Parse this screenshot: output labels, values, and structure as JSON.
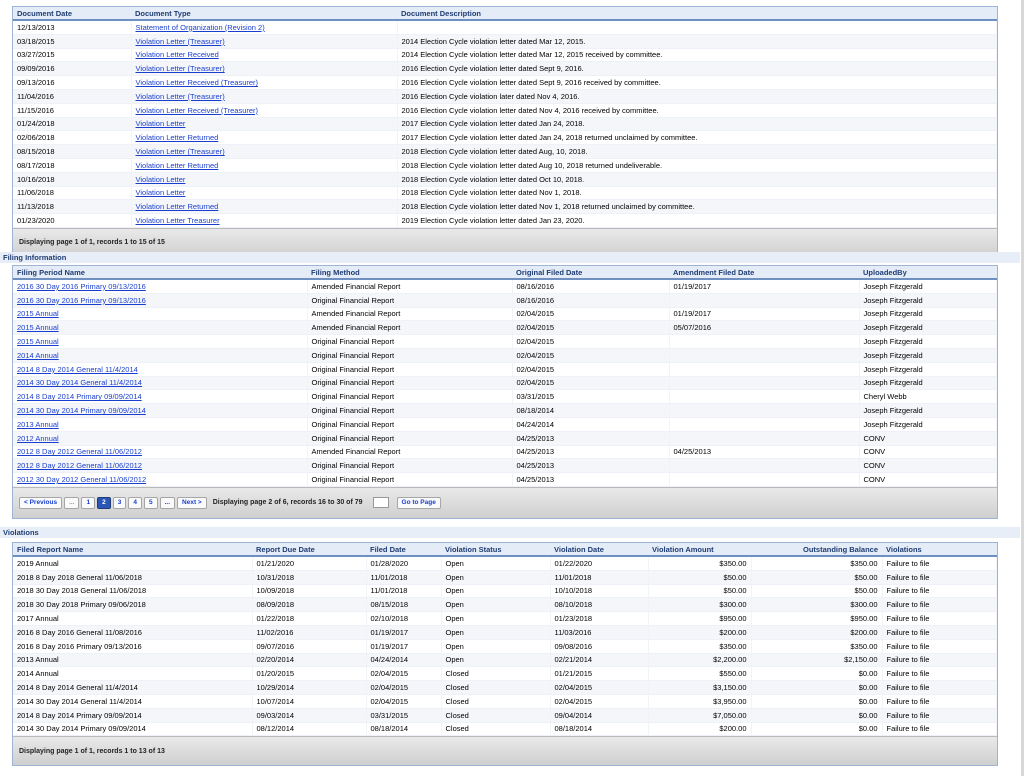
{
  "documents": {
    "headers": [
      "Document Date",
      "Document Type",
      "Document Description"
    ],
    "rows": [
      [
        "12/13/2013",
        "Statement of Organization (Revision 2)",
        ""
      ],
      [
        "03/18/2015",
        "Violation Letter (Treasurer)",
        "2014 Election Cycle violation letter dated Mar 12, 2015."
      ],
      [
        "03/27/2015",
        "Violation Letter Received",
        "2014 Election Cycle violation letter dated Mar 12, 2015 received by committee."
      ],
      [
        "09/09/2016",
        "Violation Letter (Treasurer)",
        "2016 Election Cycle violation letter dated Sept 9, 2016."
      ],
      [
        "09/13/2016",
        "Violation Letter Received (Treasurer)",
        "2016 Election Cycle violation letter dated Sept 9, 2016 received by committee."
      ],
      [
        "11/04/2016",
        "Violation Letter (Treasurer)",
        "2016 Election Cycle violation later dated Nov 4, 2016."
      ],
      [
        "11/15/2016",
        "Violation Letter Received (Treasurer)",
        "2016 Election Cycle violation letter dated Nov 4, 2016 received by committee."
      ],
      [
        "01/24/2018",
        "Violation Letter",
        "2017 Election Cycle violation letter dated Jan 24, 2018."
      ],
      [
        "02/06/2018",
        "Violation Letter Returned",
        "2017 Election Cycle violation letter dated Jan 24, 2018 returned unclaimed by committee."
      ],
      [
        "08/15/2018",
        "Violation Letter (Treasurer)",
        "2018 Election Cycle violation letter dated Aug, 10, 2018."
      ],
      [
        "08/17/2018",
        "Violation Letter Returned",
        "2018 Election Cycle violation letter dated Aug 10, 2018 returned undeliverable."
      ],
      [
        "10/16/2018",
        "Violation Letter",
        "2018 Election Cycle violation letter dated Oct 10, 2018."
      ],
      [
        "11/06/2018",
        "Violation Letter",
        "2018 Election Cycle violation letter dated Nov 1, 2018."
      ],
      [
        "11/13/2018",
        "Violation Letter Returned",
        "2018 Election Cycle violation letter dated Nov 1, 2018 returned unclaimed by committee."
      ],
      [
        "01/23/2020",
        "Violation Letter Treasurer",
        "2019 Election Cycle violation letter dated Jan 23, 2020."
      ]
    ],
    "footer": "Displaying page 1 of 1, records 1 to 15 of 15"
  },
  "filing": {
    "section_title": "Filing Information",
    "headers": [
      "Filing Period Name",
      "Filing Method",
      "Original Filed Date",
      "Amendment Filed Date",
      "UploadedBy"
    ],
    "rows": [
      [
        "2016 30 Day 2016 Primary 09/13/2016",
        "Amended Financial Report",
        "08/16/2016",
        "01/19/2017",
        "Joseph Fitzgerald"
      ],
      [
        "2016 30 Day 2016 Primary 09/13/2016",
        "Original Financial Report",
        "08/16/2016",
        "",
        "Joseph Fitzgerald"
      ],
      [
        "2015 Annual",
        "Amended Financial Report",
        "02/04/2015",
        "01/19/2017",
        "Joseph Fitzgerald"
      ],
      [
        "2015 Annual",
        "Amended Financial Report",
        "02/04/2015",
        "05/07/2016",
        "Joseph Fitzgerald"
      ],
      [
        "2015 Annual",
        "Original Financial Report",
        "02/04/2015",
        "",
        "Joseph Fitzgerald"
      ],
      [
        "2014 Annual",
        "Original Financial Report",
        "02/04/2015",
        "",
        "Joseph Fitzgerald"
      ],
      [
        "2014 8 Day 2014 General 11/4/2014",
        "Original Financial Report",
        "02/04/2015",
        "",
        "Joseph Fitzgerald"
      ],
      [
        "2014 30 Day 2014 General 11/4/2014",
        "Original Financial Report",
        "02/04/2015",
        "",
        "Joseph Fitzgerald"
      ],
      [
        "2014 8 Day 2014 Primary 09/09/2014",
        "Original Financial Report",
        "03/31/2015",
        "",
        "Cheryl Webb"
      ],
      [
        "2014 30 Day 2014 Primary 09/09/2014",
        "Original Financial Report",
        "08/18/2014",
        "",
        "Joseph Fitzgerald"
      ],
      [
        "2013 Annual",
        "Original Financial Report",
        "04/24/2014",
        "",
        "Joseph Fitzgerald"
      ],
      [
        "2012 Annual",
        "Original Financial Report",
        "04/25/2013",
        "",
        "CONV"
      ],
      [
        "2012 8 Day 2012 General 11/06/2012",
        "Amended Financial Report",
        "04/25/2013",
        "04/25/2013",
        "CONV"
      ],
      [
        "2012 8 Day 2012 General 11/06/2012",
        "Original Financial Report",
        "04/25/2013",
        "",
        "CONV"
      ],
      [
        "2012 30 Day 2012 General 11/06/2012",
        "Original Financial Report",
        "04/25/2013",
        "",
        "CONV"
      ]
    ],
    "pager": {
      "prev": "< Previous",
      "first_gap": "...",
      "pages": [
        "1",
        "2",
        "3",
        "4",
        "5"
      ],
      "current_page": "2",
      "last_gap": "...",
      "next": "Next >",
      "info": "Displaying page 2 of 6, records 16 to 30 of 79",
      "goto": "Go to Page"
    }
  },
  "violations": {
    "section_title": "Violations",
    "headers": [
      "Filed Report Name",
      "Report Due Date",
      "Filed Date",
      "Violation Status",
      "Violation Date",
      "Violation Amount",
      "Outstanding Balance",
      "Violations"
    ],
    "rows": [
      [
        "2019 Annual",
        "01/21/2020",
        "01/28/2020",
        "Open",
        "01/22/2020",
        "$350.00",
        "$350.00",
        "Failure to file"
      ],
      [
        "2018 8 Day 2018 General 11/06/2018",
        "10/31/2018",
        "11/01/2018",
        "Open",
        "11/01/2018",
        "$50.00",
        "$50.00",
        "Failure to file"
      ],
      [
        "2018 30 Day 2018 General 11/06/2018",
        "10/09/2018",
        "11/01/2018",
        "Open",
        "10/10/2018",
        "$50.00",
        "$50.00",
        "Failure to file"
      ],
      [
        "2018 30 Day 2018 Primary 09/06/2018",
        "08/09/2018",
        "08/15/2018",
        "Open",
        "08/10/2018",
        "$300.00",
        "$300.00",
        "Failure to file"
      ],
      [
        "2017 Annual",
        "01/22/2018",
        "02/10/2018",
        "Open",
        "01/23/2018",
        "$950.00",
        "$950.00",
        "Failure to file"
      ],
      [
        "2016 8 Day 2016 General 11/08/2016",
        "11/02/2016",
        "01/19/2017",
        "Open",
        "11/03/2016",
        "$200.00",
        "$200.00",
        "Failure to file"
      ],
      [
        "2016 8 Day 2016 Primary 09/13/2016",
        "09/07/2016",
        "01/19/2017",
        "Open",
        "09/08/2016",
        "$350.00",
        "$350.00",
        "Failure to file"
      ],
      [
        "2013 Annual",
        "02/20/2014",
        "04/24/2014",
        "Open",
        "02/21/2014",
        "$2,200.00",
        "$2,150.00",
        "Failure to file"
      ],
      [
        "2014 Annual",
        "01/20/2015",
        "02/04/2015",
        "Closed",
        "01/21/2015",
        "$550.00",
        "$0.00",
        "Failure to file"
      ],
      [
        "2014 8 Day 2014 General 11/4/2014",
        "10/29/2014",
        "02/04/2015",
        "Closed",
        "02/04/2015",
        "$3,150.00",
        "$0.00",
        "Failure to file"
      ],
      [
        "2014 30 Day 2014 General 11/4/2014",
        "10/07/2014",
        "02/04/2015",
        "Closed",
        "02/04/2015",
        "$3,950.00",
        "$0.00",
        "Failure to file"
      ],
      [
        "2014 8 Day 2014 Primary 09/09/2014",
        "09/03/2014",
        "03/31/2015",
        "Closed",
        "09/04/2014",
        "$7,050.00",
        "$0.00",
        "Failure to file"
      ],
      [
        "2014 30 Day 2014 Primary 09/09/2014",
        "08/12/2014",
        "08/18/2014",
        "Closed",
        "08/18/2014",
        "$200.00",
        "$0.00",
        "Failure to file"
      ]
    ],
    "footer": "Displaying page 1 of 1, records 1 to 13 of 13"
  }
}
